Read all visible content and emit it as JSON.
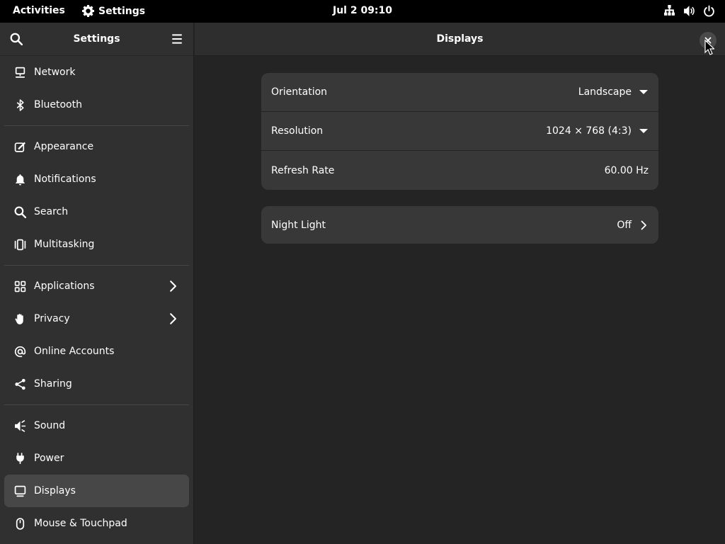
{
  "topbar": {
    "activities": "Activities",
    "app_name": "Settings",
    "app_icon": "gear-icon",
    "clock": "Jul 2  09:10",
    "tray": [
      "network-wired-icon",
      "volume-icon",
      "power-icon"
    ]
  },
  "sidebar": {
    "title": "Settings",
    "groups": [
      [
        {
          "label": "Network",
          "icon": "network-icon"
        },
        {
          "label": "Bluetooth",
          "icon": "bluetooth-icon"
        }
      ],
      [
        {
          "label": "Appearance",
          "icon": "appearance-icon"
        },
        {
          "label": "Notifications",
          "icon": "bell-icon"
        },
        {
          "label": "Search",
          "icon": "search-icon"
        },
        {
          "label": "Multitasking",
          "icon": "multitasking-icon"
        }
      ],
      [
        {
          "label": "Applications",
          "icon": "grid-icon",
          "chevron": true
        },
        {
          "label": "Privacy",
          "icon": "hand-icon",
          "chevron": true
        },
        {
          "label": "Online Accounts",
          "icon": "at-icon"
        },
        {
          "label": "Sharing",
          "icon": "share-icon"
        }
      ],
      [
        {
          "label": "Sound",
          "icon": "speaker-icon"
        },
        {
          "label": "Power",
          "icon": "power-plug-icon"
        },
        {
          "label": "Displays",
          "icon": "display-icon",
          "active": true
        },
        {
          "label": "Mouse & Touchpad",
          "icon": "mouse-icon"
        }
      ]
    ]
  },
  "main": {
    "title": "Displays",
    "display_settings": {
      "orientation": {
        "label": "Orientation",
        "value": "Landscape"
      },
      "resolution": {
        "label": "Resolution",
        "value": "1024 × 768 (4:3)"
      },
      "refresh_rate": {
        "label": "Refresh Rate",
        "value": "60.00 Hz"
      }
    },
    "night_light": {
      "label": "Night Light",
      "value": "Off"
    }
  }
}
